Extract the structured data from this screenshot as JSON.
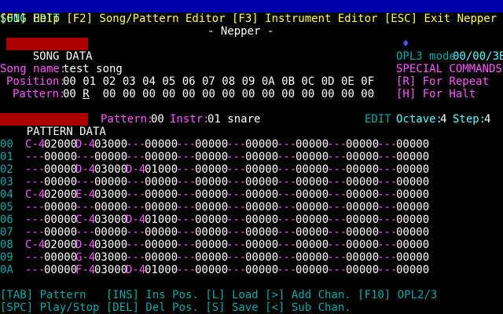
{
  "title_bar": {
    "left": "SONG EDIT",
    "center": "- Nepper -",
    "marker": "♦",
    "right": "00/00/3B"
  },
  "function_keys": "[F1] Help [F2] Song/Pattern Editor [F3] Instrument Editor [ESC] Exit Nepper",
  "song_data": {
    "section_label": "SONG DATA",
    "song_name_label": "Song name:",
    "song_name": "test song",
    "position_label": "Position:",
    "positions": "00 01 02 03 04 05 06 07 08 09 0A 0B 0C 0D 0E 0F",
    "pattern_label": "Pattern:",
    "pattern_first": "00",
    "pattern_cursor": "R",
    "pattern_rest": "  00 00 00 00 00 00 00 00 00 00 00 00 00 00"
  },
  "side_panel": {
    "mode": "OPL3 mode",
    "special_header": "SPECIAL COMMANDS:",
    "cmd_repeat": "[R] For Repeat",
    "cmd_halt": "[H] For Halt"
  },
  "pattern_header": {
    "section_label": "PATTERN DATA",
    "pattern_label": "Pattern:",
    "pattern_value": "00",
    "instr_label": "Instr:",
    "instr_value": "01 snare",
    "edit_label": "EDIT",
    "octave_label": "Octave:",
    "octave_value": "4",
    "step_label": "Step:",
    "step_value": "4"
  },
  "pattern_rows": [
    {
      "num": "00",
      "cells": [
        [
          "C-4",
          "02000"
        ],
        [
          "D-4",
          "03000"
        ],
        [
          "---",
          "00000"
        ],
        [
          "---",
          "00000"
        ],
        [
          "---",
          "00000"
        ],
        [
          "---",
          "00000"
        ],
        [
          "---",
          "00000"
        ],
        [
          "---",
          "00000"
        ]
      ]
    },
    {
      "num": "01",
      "cells": [
        [
          "---",
          "00000"
        ],
        [
          "---",
          "00000"
        ],
        [
          "---",
          "00000"
        ],
        [
          "---",
          "00000"
        ],
        [
          "---",
          "00000"
        ],
        [
          "---",
          "00000"
        ],
        [
          "---",
          "00000"
        ],
        [
          "---",
          "00000"
        ]
      ]
    },
    {
      "num": "02",
      "cells": [
        [
          "---",
          "00000"
        ],
        [
          "D-4",
          "03000"
        ],
        [
          "D-4",
          "01000"
        ],
        [
          "---",
          "00000"
        ],
        [
          "---",
          "00000"
        ],
        [
          "---",
          "00000"
        ],
        [
          "---",
          "00000"
        ],
        [
          "---",
          "00000"
        ]
      ]
    },
    {
      "num": "03",
      "cells": [
        [
          "---",
          "00000"
        ],
        [
          "---",
          "00000"
        ],
        [
          "---",
          "00000"
        ],
        [
          "---",
          "00000"
        ],
        [
          "---",
          "00000"
        ],
        [
          "---",
          "00000"
        ],
        [
          "---",
          "00000"
        ],
        [
          "---",
          "00000"
        ]
      ]
    },
    {
      "num": "04",
      "cells": [
        [
          "C-4",
          "02000"
        ],
        [
          "E-4",
          "03000"
        ],
        [
          "---",
          "00000"
        ],
        [
          "---",
          "00000"
        ],
        [
          "---",
          "00000"
        ],
        [
          "---",
          "00000"
        ],
        [
          "---",
          "00000"
        ],
        [
          "---",
          "00000"
        ]
      ]
    },
    {
      "num": "05",
      "cells": [
        [
          "---",
          "00000"
        ],
        [
          "---",
          "00000"
        ],
        [
          "---",
          "00000"
        ],
        [
          "---",
          "00000"
        ],
        [
          "---",
          "00000"
        ],
        [
          "---",
          "00000"
        ],
        [
          "---",
          "00000"
        ],
        [
          "---",
          "00000"
        ]
      ]
    },
    {
      "num": "06",
      "cells": [
        [
          "---",
          "00000"
        ],
        [
          "C-4",
          "03000"
        ],
        [
          "D-4",
          "01000"
        ],
        [
          "---",
          "00000"
        ],
        [
          "---",
          "00000"
        ],
        [
          "---",
          "00000"
        ],
        [
          "---",
          "00000"
        ],
        [
          "---",
          "00000"
        ]
      ]
    },
    {
      "num": "07",
      "cells": [
        [
          "---",
          "00000"
        ],
        [
          "---",
          "00000"
        ],
        [
          "---",
          "00000"
        ],
        [
          "---",
          "00000"
        ],
        [
          "---",
          "00000"
        ],
        [
          "---",
          "00000"
        ],
        [
          "---",
          "00000"
        ],
        [
          "---",
          "00000"
        ]
      ]
    },
    {
      "num": "08",
      "cells": [
        [
          "C-4",
          "02000"
        ],
        [
          "D-4",
          "03000"
        ],
        [
          "---",
          "00000"
        ],
        [
          "---",
          "00000"
        ],
        [
          "---",
          "00000"
        ],
        [
          "---",
          "00000"
        ],
        [
          "---",
          "00000"
        ],
        [
          "---",
          "00000"
        ]
      ]
    },
    {
      "num": "09",
      "cells": [
        [
          "---",
          "00000"
        ],
        [
          "G-4",
          "03000"
        ],
        [
          "---",
          "00000"
        ],
        [
          "---",
          "00000"
        ],
        [
          "---",
          "00000"
        ],
        [
          "---",
          "00000"
        ],
        [
          "---",
          "00000"
        ],
        [
          "---",
          "00000"
        ]
      ]
    },
    {
      "num": "0A",
      "cells": [
        [
          "---",
          "00000"
        ],
        [
          "F-4",
          "03000"
        ],
        [
          "D-4",
          "01000"
        ],
        [
          "---",
          "00000"
        ],
        [
          "---",
          "00000"
        ],
        [
          "---",
          "00000"
        ],
        [
          "---",
          "00000"
        ],
        [
          "---",
          "00000"
        ]
      ]
    }
  ],
  "footer": {
    "line1": "[TAB] Pattern   [INS] Ins Pos. [L] Load [>] Add Chan. [F10] OPL2/3",
    "line2": "[SPC] Play/Stop [DEL] Del Pos. [S] Save [<] Sub Chan."
  },
  "colors": {
    "background": "#000000",
    "title_bar_bg": "#0000aa",
    "yellow": "#ffff55",
    "cyan": "#55ffff",
    "teal": "#00aaaa",
    "label_bg": "#aa0000",
    "note": "#ff55ff"
  }
}
